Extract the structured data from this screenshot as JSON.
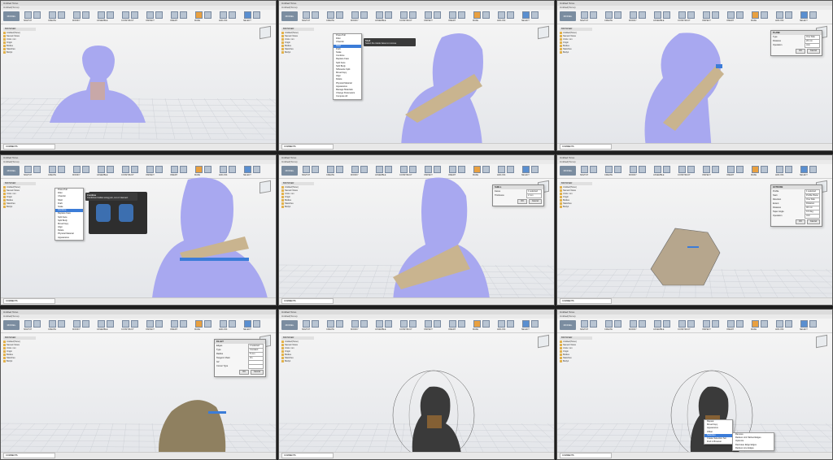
{
  "app": {
    "toolbar_groups": [
      "SKETCH",
      "CREATE",
      "MODIFY",
      "ASSEMBLE",
      "CONSTRUCT",
      "INSPECT",
      "INSERT",
      "MAKE",
      "ADD-INS",
      "SELECT"
    ],
    "mode_label": "MODEL",
    "comments_label": "COMMENTS"
  },
  "panels": [
    {
      "title": "Untitled Torso",
      "tab": "Untitled(Torso)",
      "browser": [
        "Untitled(Torso)",
        "Named Views",
        "Units: mm",
        "Origin",
        "Bodies",
        "Sketches",
        "Body1"
      ]
    },
    {
      "title": "Untitled Torso",
      "tab": "Untitled(Torso)",
      "browser": [
        "Untitled(Torso)",
        "Named Views",
        "Units: mm",
        "Origin",
        "Bodies",
        "Sketches",
        "Body1"
      ],
      "menu": [
        "Press Pull",
        "Fillet",
        "Chamfer",
        "Shell",
        "Draft",
        "Scale",
        "Combine",
        "Replace Face",
        "Split Face",
        "Split Body",
        "Silhouette Split",
        "Move/Copy",
        "Align",
        "Delete",
        "Physical Material",
        "Appearance",
        "Manage Materials",
        "Change Parameters",
        "Compute All"
      ],
      "highlight": "Shell",
      "tooltip_title": "Shell",
      "tooltip_body": "Select the inside faces to remove"
    },
    {
      "title": "Untitled Torso",
      "tab": "Untitled(Torso)",
      "browser": [
        "Untitled(Torso)",
        "Named Views",
        "Units: mm",
        "Origin",
        "Bodies",
        "Sketches",
        "Body1"
      ],
      "dialog": {
        "title": "PLANE",
        "rows": [
          [
            "Type",
            "One Side"
          ],
          [
            "Distance",
            "20 mm"
          ],
          [
            "Operation",
            "Join"
          ]
        ]
      }
    },
    {
      "title": "Untitled Torso",
      "tab": "Untitled(Torso)",
      "browser": [
        "Untitled(Torso)",
        "Named Views",
        "Units: mm",
        "Origin",
        "Bodies",
        "Sketches",
        "Body1"
      ],
      "menu": [
        "Press Pull",
        "Fillet",
        "Chamfer",
        "Shell",
        "Draft",
        "Scale",
        "Combine",
        "Replace Face",
        "Split Face",
        "Split Body",
        "Move/Copy",
        "Align",
        "Delete",
        "Physical Material",
        "Appearance"
      ],
      "highlight": "Combine",
      "tooltip_title": "Combine",
      "tooltip_body": "Combines bodies using join, cut or intersect"
    },
    {
      "title": "Untitled Torso",
      "tab": "Untitled(Torso)",
      "browser": [
        "Untitled(Torso)",
        "Named Views",
        "Units: mm",
        "Origin",
        "Bodies",
        "Sketches",
        "Body1"
      ],
      "dialog": {
        "title": "SHELL",
        "rows": [
          [
            "Faces",
            "1 selected"
          ],
          [
            "Thickness",
            "2 mm"
          ]
        ]
      }
    },
    {
      "title": "Untitled Torso",
      "tab": "Untitled(Torso)",
      "browser": [
        "Untitled(Torso)",
        "Named Views",
        "Units: mm",
        "Origin",
        "Bodies",
        "Sketches",
        "Body1"
      ],
      "dialog": {
        "title": "EXTRUDE",
        "rows": [
          [
            "Profile",
            "1 selected"
          ],
          [
            "Start",
            "Profile Plane"
          ],
          [
            "Direction",
            "One Side"
          ],
          [
            "Extent",
            "Distance"
          ],
          [
            "Distance",
            "40 mm"
          ],
          [
            "Taper Angle",
            "0.0 deg"
          ],
          [
            "Operation",
            "Join"
          ]
        ]
      }
    },
    {
      "title": "Untitled Torso",
      "tab": "Untitled(Torso)",
      "browser": [
        "Untitled(Torso)",
        "Named Views",
        "Units: mm",
        "Origin",
        "Bodies",
        "Sketches",
        "Body1"
      ],
      "dialog": {
        "title": "FILLET",
        "rows": [
          [
            "Edges",
            "2 selected"
          ],
          [
            "Type",
            "Constant Radius"
          ],
          [
            "Radius",
            "5 mm"
          ],
          [
            "Tangent Chain",
            "On"
          ],
          [
            "G2",
            ""
          ],
          [
            "Corner Type",
            ""
          ]
        ]
      }
    },
    {
      "title": "Untitled Torso",
      "tab": "Untitled(Torso)",
      "browser": [
        "Untitled(Torso)",
        "Named Views",
        "Units: mm",
        "Origin",
        "Bodies",
        "Sketches",
        "Body1"
      ]
    },
    {
      "title": "Untitled Torso",
      "tab": "Untitled(Torso)",
      "browser": [
        "Untitled(Torso)",
        "Named Views",
        "Units: mm",
        "Origin",
        "Bodies",
        "Sketches",
        "Body1"
      ],
      "menu": [
        "Repeat",
        "Move/Copy",
        "Appearance",
        "Offset",
        "Selection",
        "Create Selection Set",
        "Find in Browser"
      ],
      "highlight": "Selection",
      "submenu": [
        "Remove",
        "Reduce Unit Tabbed Edges",
        "Optimize",
        "Decrease Edge Edges",
        "Reduce Line Edges"
      ]
    }
  ],
  "colors": {
    "mesh": "#a8a8f0",
    "mesh_dark": "#6d6dc8",
    "brep": "#c9b48f",
    "dark_mesh": "#3a3a3a",
    "selected": "#3b7cd8"
  }
}
